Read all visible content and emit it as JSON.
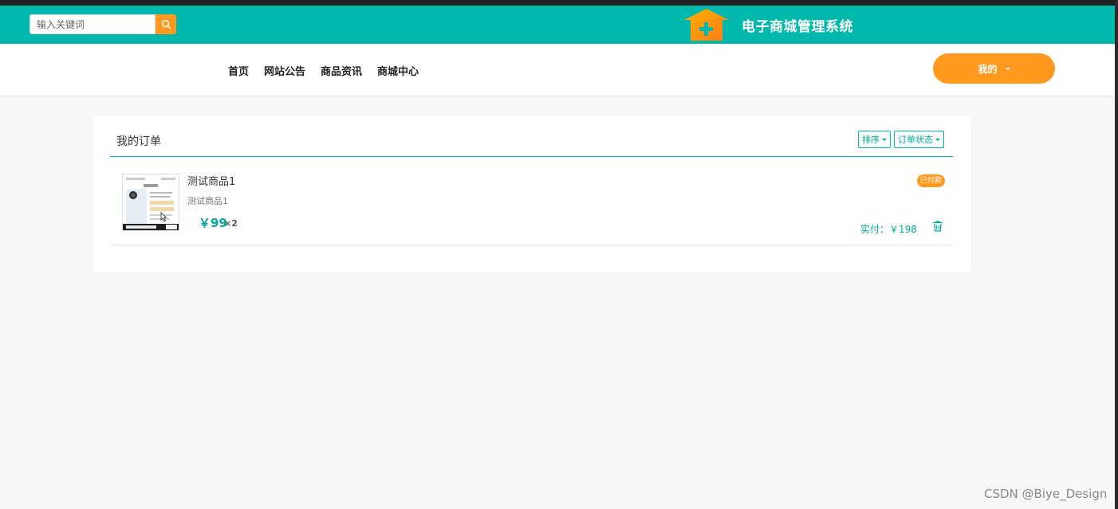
{
  "header": {
    "search_placeholder": "输入关键词",
    "site_title": "电子商城管理系统",
    "brand_color": "#00b8ab",
    "accent_color": "#ff9a1f"
  },
  "nav": {
    "links": [
      {
        "label": "首页"
      },
      {
        "label": "网站公告"
      },
      {
        "label": "商品资讯"
      },
      {
        "label": "商城中心"
      }
    ],
    "user_menu_label": "我的"
  },
  "orders": {
    "title": "我的订单",
    "sort_label": "排序",
    "status_filter_label": "订单状态",
    "items": [
      {
        "name": "测试商品1",
        "description": "测试商品1",
        "price": "￥99",
        "quantity": "×2",
        "status": "已付款",
        "paid_amount": "实付：￥198"
      }
    ]
  },
  "watermark": "CSDN @Biye_Design"
}
